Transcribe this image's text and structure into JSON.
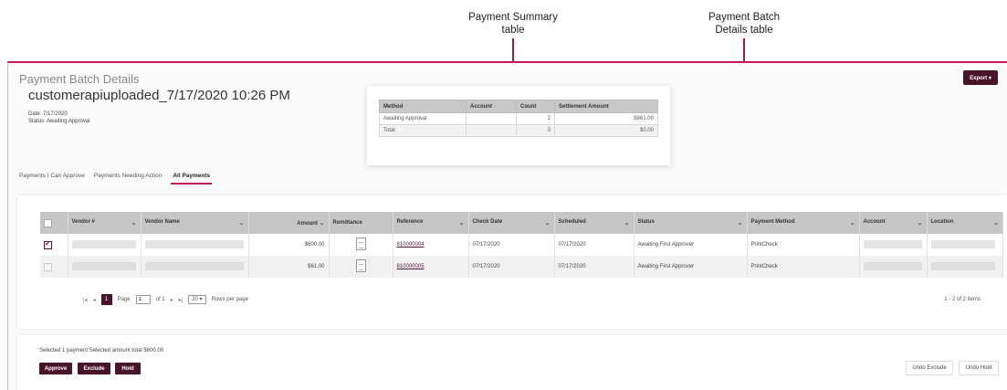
{
  "callouts": {
    "summary": [
      "Payment Summary",
      "table"
    ],
    "details": [
      "Payment Batch",
      "Details table"
    ]
  },
  "header": {
    "title": "Payment Batch Details",
    "batch_name": "customerapiuploaded_7/17/2020 10:26 PM",
    "date": "Date: 7/17/2020",
    "status": "Status: Awaiting Approval",
    "export_label": "Export ▾"
  },
  "summary": {
    "columns": [
      "Method",
      "Account",
      "Count",
      "Settlement Amount"
    ],
    "rows": [
      [
        "Awaiting Approval",
        "",
        "2",
        "$661.00"
      ],
      [
        "Total",
        "",
        "0",
        "$0.00"
      ]
    ]
  },
  "tabs": [
    "Payments I Can Approve",
    "Payments Needing Action",
    "All Payments"
  ],
  "active_tab": "All Payments",
  "grid": {
    "columns": [
      "Vendor #",
      "Vendor Name",
      "Amount",
      "Remittance",
      "Reference",
      "Check Date",
      "Scheduled",
      "Status",
      "Payment Method",
      "Account",
      "Location"
    ],
    "rows": [
      {
        "checked": true,
        "amount": "$600.00",
        "reference": "810000004",
        "check_date": "07/17/2020",
        "scheduled": "07/17/2020",
        "status": "Awaiting First Approver",
        "method": "PrintCheck"
      },
      {
        "checked": false,
        "amount": "$61.00",
        "reference": "810000005",
        "check_date": "07/17/2020",
        "scheduled": "07/17/2020",
        "status": "Awaiting First Approver",
        "method": "PrintCheck"
      }
    ]
  },
  "pager": {
    "first": "|◂",
    "prev": "◂",
    "current": "1",
    "page_label": "Page",
    "page_value": "1",
    "of_label": "of 1",
    "next": "▸",
    "last": "▸|",
    "per_page": "20 ▾",
    "per_page_label": "Rows per page",
    "items": "1 - 2 of 2 items"
  },
  "footer": {
    "selection": "Selected 1 payment   Selected amount total $600.00",
    "approve": "Approve",
    "exclude": "Exclude",
    "hold": "Hold",
    "undo_exclude": "Undo Exclude",
    "undo_hold": "Undo Hold"
  },
  "colors": {
    "accent": "#c2185b",
    "button": "#4a1428"
  }
}
